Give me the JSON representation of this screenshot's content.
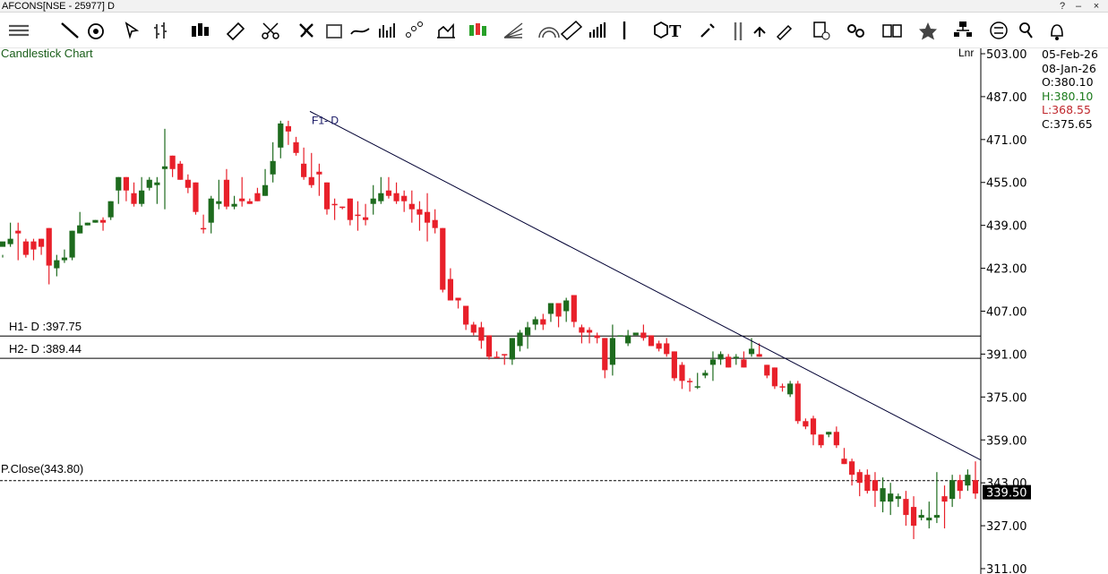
{
  "window": {
    "title": "AFCONS[NSE - 25977] D",
    "close_label": "×",
    "help_label": "?"
  },
  "toolbar": {
    "items": [
      {
        "name": "menu-lines-icon"
      },
      {
        "name": "line-tool-icon"
      },
      {
        "name": "target-icon"
      },
      {
        "name": "cursor-icon"
      },
      {
        "name": "bar-chart-icon"
      },
      {
        "name": "candlestick-icon"
      },
      {
        "name": "ruler-icon"
      },
      {
        "name": "scissors-icon"
      },
      {
        "name": "cross-arrows-icon"
      },
      {
        "name": "rectangle-icon"
      },
      {
        "name": "curve-icon"
      },
      {
        "name": "indicator-icon"
      },
      {
        "name": "scatter-icon"
      },
      {
        "name": "area-icon"
      },
      {
        "name": "heikin-icon"
      },
      {
        "name": "fan-icon"
      },
      {
        "name": "arc-icon"
      },
      {
        "name": "measure-icon"
      },
      {
        "name": "volume-bars-icon"
      },
      {
        "name": "vertical-line-icon"
      },
      {
        "name": "cube-icon"
      },
      {
        "name": "text-tool-icon"
      },
      {
        "name": "wrench-icon"
      },
      {
        "name": "parallel-lines-icon"
      },
      {
        "name": "undo-icon"
      },
      {
        "name": "pencil-icon"
      },
      {
        "name": "delete-icon"
      },
      {
        "name": "link-icon"
      },
      {
        "name": "book-icon"
      },
      {
        "name": "star-icon"
      },
      {
        "name": "network-icon"
      },
      {
        "name": "swap-icon"
      },
      {
        "name": "pin-icon"
      },
      {
        "name": "alert-icon"
      }
    ]
  },
  "chart": {
    "chart_type_label": "Candlestick Chart",
    "scale_label": "Lnr",
    "ohlc": {
      "date1": "05-Feb-26",
      "date2": "08-Jan-26",
      "open": "O:380.10",
      "high": "H:380.10",
      "low": "L:368.55",
      "close": "C:375.65"
    },
    "levels": {
      "h1_label": "H1- D :397.75",
      "h2_label": "H2- D :389.44",
      "prev_close_label": "P.Close(343.80)",
      "fib_label": "F1- D",
      "current_price": "339.50"
    },
    "y_ticks": [
      "503.00",
      "487.00",
      "471.00",
      "455.00",
      "439.00",
      "423.00",
      "407.00",
      "391.00",
      "375.00",
      "359.00",
      "343.00",
      "327.00",
      "311.00"
    ],
    "colors": {
      "up": "#1e6b1e",
      "down": "#e8202a",
      "line": "#000000",
      "text_green": "#1a5e1a",
      "text_red": "#c0282d"
    }
  },
  "chart_data": {
    "type": "candlestick",
    "ylim": [
      309,
      505
    ],
    "h1": 397.75,
    "h2": 389.44,
    "prev_close": 343.8,
    "trendline": [
      [
        0.0,
        481.5
      ],
      [
        1.0,
        351.5
      ]
    ],
    "candles": [
      [
        431,
        433,
        428,
        427,
        "G"
      ],
      [
        434,
        432,
        440,
        431,
        "G"
      ],
      [
        436,
        437,
        440,
        426,
        "R"
      ],
      [
        433,
        428,
        434,
        427,
        "R"
      ],
      [
        433,
        430,
        434,
        426,
        "R"
      ],
      [
        434,
        431,
        434,
        428,
        "R"
      ],
      [
        438,
        424,
        438,
        417,
        "R"
      ],
      [
        423,
        426,
        428,
        420,
        "G"
      ],
      [
        426,
        427,
        430,
        425,
        "G"
      ],
      [
        427,
        437,
        437,
        426,
        "G"
      ],
      [
        436,
        439,
        444,
        436,
        "G"
      ],
      [
        439,
        440,
        440,
        439,
        "G"
      ],
      [
        440,
        441,
        441,
        440,
        "G"
      ],
      [
        441,
        440,
        442,
        437,
        "R"
      ],
      [
        442,
        448,
        448,
        441,
        "G"
      ],
      [
        452,
        457,
        457,
        447,
        "G"
      ],
      [
        457,
        452,
        457,
        448,
        "R"
      ],
      [
        451,
        447,
        455,
        446,
        "R"
      ],
      [
        447,
        452,
        457,
        446,
        "G"
      ],
      [
        453,
        456,
        457,
        452,
        "G"
      ],
      [
        454,
        455,
        457,
        447,
        "G"
      ],
      [
        460,
        461,
        475,
        445,
        "G"
      ],
      [
        465,
        460,
        465,
        457,
        "R"
      ],
      [
        462,
        456,
        463,
        456,
        "R"
      ],
      [
        456,
        453,
        458,
        451,
        "R"
      ],
      [
        455,
        444,
        455,
        443,
        "R"
      ],
      [
        438,
        438,
        443,
        436,
        "R"
      ],
      [
        449,
        440,
        450,
        436,
        "G"
      ],
      [
        448,
        447,
        456,
        445,
        "G"
      ],
      [
        456,
        446,
        460,
        445,
        "R"
      ],
      [
        446,
        447,
        450,
        445,
        "G"
      ],
      [
        449,
        448,
        457,
        446,
        "R"
      ],
      [
        448,
        447,
        449,
        447,
        "R"
      ],
      [
        451,
        448,
        453,
        448,
        "R"
      ],
      [
        450,
        454,
        460,
        450,
        "G"
      ],
      [
        458,
        463,
        470,
        455,
        "G"
      ],
      [
        468,
        477,
        478,
        464,
        "G"
      ],
      [
        476,
        474,
        478,
        469,
        "R"
      ],
      [
        470,
        466,
        472,
        465,
        "R"
      ],
      [
        462,
        457,
        468,
        456,
        "R"
      ],
      [
        457,
        454,
        466,
        453,
        "R"
      ],
      [
        459,
        458,
        462,
        450,
        "R"
      ],
      [
        455,
        445,
        455,
        443,
        "R"
      ],
      [
        447,
        447,
        449,
        441,
        "R"
      ],
      [
        446,
        446,
        446,
        445,
        "R"
      ],
      [
        449,
        441,
        449,
        439,
        "R"
      ],
      [
        443,
        443,
        448,
        437,
        "R"
      ],
      [
        441,
        442,
        447,
        439,
        "R"
      ],
      [
        447,
        449,
        454,
        443,
        "G"
      ],
      [
        448,
        451,
        457,
        447,
        "G"
      ],
      [
        452,
        450,
        457,
        449,
        "R"
      ],
      [
        451,
        448,
        455,
        447,
        "R"
      ],
      [
        450,
        448,
        452,
        444,
        "R"
      ],
      [
        447,
        445,
        452,
        440,
        "R"
      ],
      [
        445,
        443,
        448,
        437,
        "R"
      ],
      [
        444,
        440,
        451,
        433,
        "R"
      ],
      [
        441,
        438,
        445,
        436,
        "R"
      ],
      [
        438,
        415,
        438,
        414,
        "R"
      ],
      [
        419,
        411,
        423,
        411,
        "R"
      ],
      [
        412,
        411,
        412,
        408,
        "R"
      ],
      [
        409,
        402,
        409,
        400,
        "R"
      ],
      [
        402,
        399,
        403,
        398,
        "R"
      ],
      [
        401,
        396,
        403,
        393,
        "R"
      ],
      [
        398,
        390,
        398,
        389,
        "R"
      ],
      [
        390,
        390,
        392,
        390,
        "R"
      ],
      [
        391,
        391,
        391,
        387,
        "R"
      ],
      [
        389,
        397,
        397,
        387,
        "G"
      ],
      [
        394,
        399,
        400,
        392,
        "G"
      ],
      [
        398,
        401,
        403,
        393,
        "G"
      ],
      [
        402,
        404,
        405,
        400,
        "G"
      ],
      [
        404,
        402,
        406,
        400,
        "R"
      ],
      [
        406,
        410,
        410,
        403,
        "G"
      ],
      [
        410,
        405,
        410,
        401,
        "R"
      ],
      [
        411,
        407,
        412,
        403,
        "G"
      ],
      [
        413,
        403,
        413,
        401,
        "R"
      ],
      [
        401,
        399,
        402,
        395,
        "R"
      ],
      [
        400,
        399,
        401,
        395,
        "R"
      ],
      [
        398,
        397,
        399,
        395,
        "R"
      ],
      [
        397,
        385,
        397,
        382,
        "R"
      ],
      [
        387,
        397,
        402,
        383,
        "G"
      ],
      [
        398,
        398,
        398,
        398,
        "G"
      ],
      [
        398,
        395,
        400,
        394,
        "G"
      ],
      [
        398,
        399,
        399,
        399,
        "G"
      ],
      [
        399,
        397,
        402,
        396,
        "R"
      ],
      [
        398,
        394,
        398,
        394,
        "R"
      ],
      [
        395,
        393,
        396,
        392,
        "R"
      ],
      [
        395,
        391,
        397,
        390,
        "R"
      ],
      [
        392,
        382,
        392,
        381,
        "R"
      ],
      [
        387,
        381,
        388,
        378,
        "R"
      ],
      [
        381,
        381,
        382,
        377,
        "R"
      ],
      [
        379,
        379,
        384,
        378,
        "G"
      ],
      [
        384,
        383,
        385,
        382,
        "G"
      ],
      [
        387,
        389,
        392,
        381,
        "G"
      ],
      [
        389,
        391,
        392,
        387,
        "G"
      ],
      [
        390,
        386,
        391,
        386,
        "R"
      ],
      [
        390,
        390,
        391,
        387,
        "G"
      ],
      [
        389,
        386,
        392,
        386,
        "R"
      ],
      [
        391,
        393,
        397,
        390,
        "G"
      ],
      [
        391,
        390,
        395,
        390,
        "R"
      ],
      [
        387,
        383,
        387,
        382,
        "R"
      ],
      [
        386,
        379,
        386,
        378,
        "R"
      ],
      [
        379,
        379,
        380,
        377,
        "R"
      ],
      [
        380,
        376,
        381,
        375,
        "G"
      ],
      [
        380,
        366,
        381,
        365,
        "R"
      ],
      [
        366,
        364,
        367,
        363,
        "R"
      ],
      [
        367,
        361,
        368,
        357,
        "R"
      ],
      [
        361,
        357,
        361,
        356,
        "R"
      ],
      [
        361,
        362,
        362,
        360,
        "G"
      ],
      [
        362,
        357,
        364,
        356,
        "R"
      ],
      [
        352,
        350,
        356,
        350,
        "R"
      ],
      [
        351,
        346,
        352,
        342,
        "R"
      ],
      [
        347,
        343,
        348,
        338,
        "R"
      ],
      [
        346,
        340,
        348,
        339,
        "R"
      ],
      [
        344,
        340,
        347,
        334,
        "R"
      ],
      [
        341,
        336,
        345,
        332,
        "G"
      ],
      [
        339,
        336,
        343,
        331,
        "G"
      ],
      [
        338,
        337,
        339,
        334,
        "G"
      ],
      [
        337,
        331,
        340,
        327,
        "R"
      ],
      [
        334,
        327,
        338,
        322,
        "R"
      ],
      [
        331,
        330,
        333,
        329,
        "G"
      ],
      [
        329,
        330,
        336,
        326,
        "G"
      ],
      [
        330,
        331,
        347,
        328,
        "G"
      ],
      [
        336,
        338,
        342,
        326,
        "R"
      ],
      [
        337,
        344,
        346,
        334,
        "G"
      ],
      [
        344,
        340,
        346,
        337,
        "R"
      ],
      [
        342,
        346,
        348,
        340,
        "G"
      ],
      [
        344,
        339,
        351,
        337,
        "R"
      ]
    ]
  }
}
